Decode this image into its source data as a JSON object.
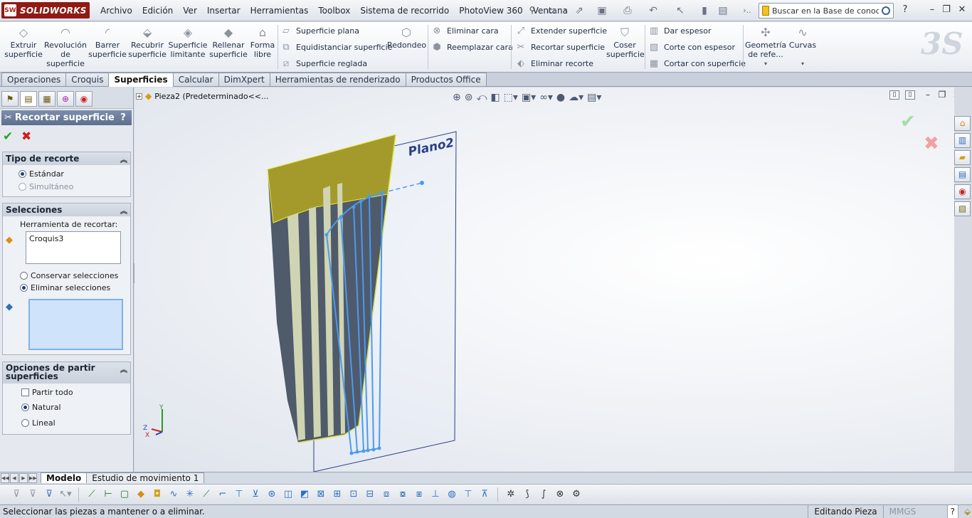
{
  "app": {
    "brand": "SOLIDWORKS",
    "logo_badge": "SW"
  },
  "menu": [
    "Archivo",
    "Edición",
    "Ver",
    "Insertar",
    "Herramientas",
    "Toolbox",
    "Sistema de recorrido",
    "PhotoView 360",
    "Ventana"
  ],
  "search": {
    "placeholder": "Buscar en la Base de conoc"
  },
  "title_controls": {
    "help": "?",
    "more": "›..",
    "minimize": "–",
    "restore": "❐",
    "close": "✕"
  },
  "ribbon": {
    "big": [
      {
        "id": "extruir",
        "label": "Extruir superficie"
      },
      {
        "id": "revolucion",
        "label": "Revolución de superficie"
      },
      {
        "id": "barrer",
        "label": "Barrer superficie"
      },
      {
        "id": "recubrir",
        "label": "Recubrir superficie"
      },
      {
        "id": "limitante",
        "label": "Superficie limitante"
      },
      {
        "id": "rellenar",
        "label": "Rellenar superficie"
      },
      {
        "id": "forma",
        "label": "Forma libre"
      },
      {
        "id": "redondeo",
        "label": "Redondeo"
      },
      {
        "id": "coser",
        "label": "Coser superficie"
      },
      {
        "id": "geometria",
        "label": "Geometría de refe..."
      },
      {
        "id": "curvas",
        "label": "Curvas"
      }
    ],
    "small": [
      {
        "id": "plana",
        "label": "Superficie plana"
      },
      {
        "id": "equidistanciar",
        "label": "Equidistanciar superficie"
      },
      {
        "id": "reglada",
        "label": "Superficie reglada"
      },
      {
        "id": "eliminar-cara",
        "label": "Eliminar cara"
      },
      {
        "id": "reemplazar-cara",
        "label": "Reemplazar cara"
      },
      {
        "id": "extender",
        "label": "Extender superficie"
      },
      {
        "id": "recortar",
        "label": "Recortar superficie"
      },
      {
        "id": "eliminar-recorte",
        "label": "Eliminar recorte"
      },
      {
        "id": "dar-espesor",
        "label": "Dar espesor"
      },
      {
        "id": "corte-espesor",
        "label": "Corte con espesor"
      },
      {
        "id": "cortar-superficie",
        "label": "Cortar con superficie"
      }
    ]
  },
  "tabs": [
    {
      "label": "Operaciones",
      "active": false
    },
    {
      "label": "Croquis",
      "active": false
    },
    {
      "label": "Superficies",
      "active": true
    },
    {
      "label": "Calcular",
      "active": false
    },
    {
      "label": "DimXpert",
      "active": false
    },
    {
      "label": "Herramientas de renderizado",
      "active": false
    },
    {
      "label": "Productos Office",
      "active": false
    }
  ],
  "property_manager": {
    "title": "Recortar superficie",
    "help": "?",
    "ok": "✔",
    "cancel": "✖",
    "tipo": {
      "header": "Tipo de recorte",
      "opt1": "Estándar",
      "opt2": "Simultáneo"
    },
    "selecciones": {
      "header": "Selecciones",
      "tool_label": "Herramienta de recortar:",
      "tool_value": "Croquis3",
      "keep": "Conservar selecciones",
      "remove": "Eliminar selecciones"
    },
    "partir": {
      "header": "Opciones de partir superficies",
      "all": "Partir todo",
      "natural": "Natural",
      "linear": "Lineal"
    }
  },
  "viewport": {
    "tree_node": "Pieza2  (Predeterminado<<...",
    "plane_label": "Plano2",
    "triad": {
      "x": "X",
      "y": "Y",
      "z": "Z"
    }
  },
  "bottom_tabs": [
    {
      "label": "Modelo",
      "active": true
    },
    {
      "label": "Estudio de movimiento 1",
      "active": false
    }
  ],
  "status": {
    "message": "Seleccionar las piezas a mantener o a eliminar.",
    "mode": "Editando Pieza",
    "units": "MMGS",
    "help": "?"
  },
  "colors": {
    "surface_fill": "#a49a2c",
    "surface_dark": "#4f5a6b",
    "sketch": "#4a9bf0",
    "plane_edge": "#2b3f86",
    "title_bar": "#5d6f8d"
  }
}
